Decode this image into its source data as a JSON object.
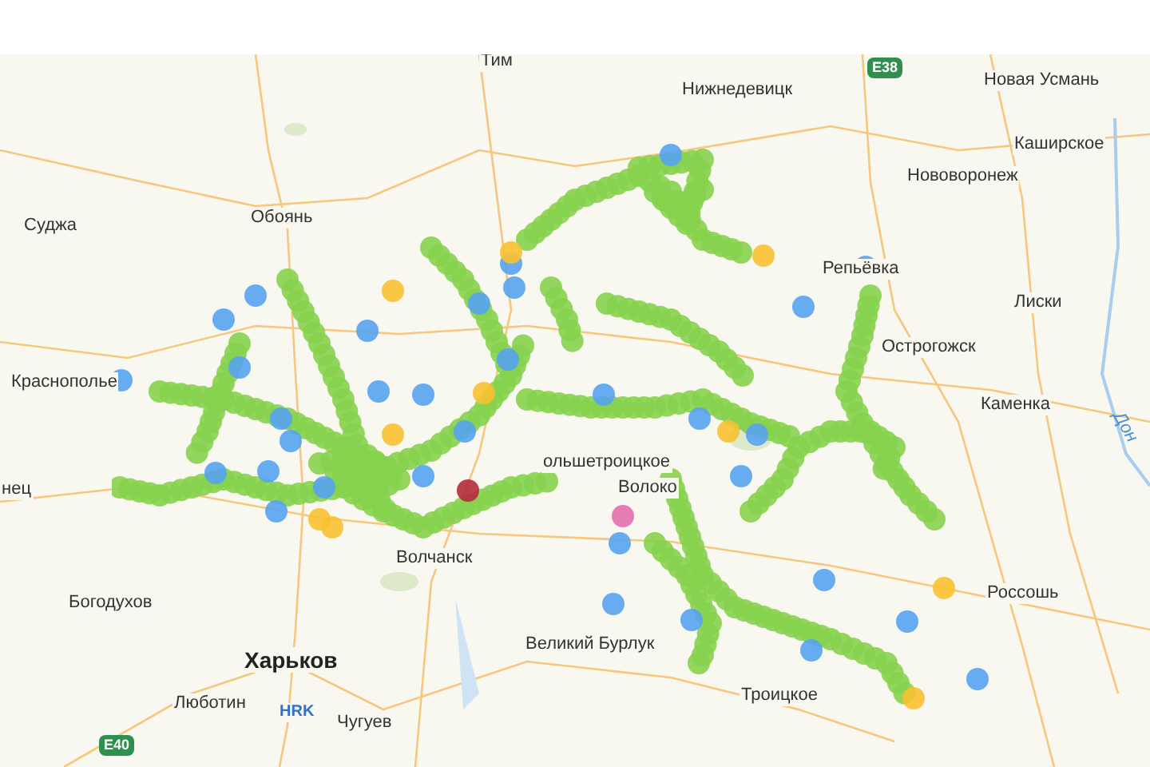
{
  "map": {
    "labels": [
      {
        "text": "Тим",
        "kind": "town"
      },
      {
        "text": "Нижнедевицк",
        "kind": "town"
      },
      {
        "text": "E38",
        "kind": "shield"
      },
      {
        "text": "Новая Усмань",
        "kind": "town"
      },
      {
        "text": "Каширское",
        "kind": "town"
      },
      {
        "text": "Нововоронеж",
        "kind": "town"
      },
      {
        "text": "Суджа",
        "kind": "town"
      },
      {
        "text": "Обоянь",
        "kind": "town"
      },
      {
        "text": "Репьёвка",
        "kind": "town"
      },
      {
        "text": "Лиски",
        "kind": "town"
      },
      {
        "text": "Острогожск",
        "kind": "town"
      },
      {
        "text": "Краснополье",
        "kind": "town"
      },
      {
        "text": "Каменка",
        "kind": "town"
      },
      {
        "text": "Дон",
        "kind": "river"
      },
      {
        "text": "нец",
        "kind": "town"
      },
      {
        "text": "ольшетроицкое",
        "kind": "town"
      },
      {
        "text": "Волоко",
        "kind": "town"
      },
      {
        "text": "Россошь",
        "kind": "town"
      },
      {
        "text": "Волчанск",
        "kind": "town"
      },
      {
        "text": "Богодухов",
        "kind": "town"
      },
      {
        "text": "Великий Бурлук",
        "kind": "town"
      },
      {
        "text": "Харьков",
        "kind": "city"
      },
      {
        "text": "Троицкое",
        "kind": "town"
      },
      {
        "text": "Люботин",
        "kind": "town"
      },
      {
        "text": "HRK",
        "kind": "airport"
      },
      {
        "text": "Чугуев",
        "kind": "town"
      },
      {
        "text": "E40",
        "kind": "shield"
      }
    ]
  }
}
